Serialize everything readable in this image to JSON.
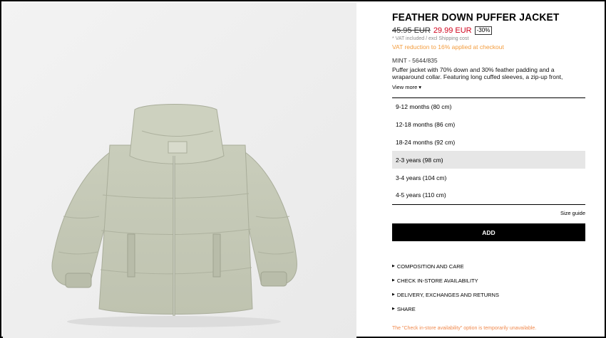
{
  "product": {
    "title": "FEATHER DOWN PUFFER JACKET",
    "old_price": "45.95 EUR",
    "new_price": "29.99 EUR",
    "discount": "-30%",
    "vat_note": "* VAT included / excl Shipping cost",
    "vat_reduction": "VAT reduction to 16% applied at checkout",
    "color_ref": "MINT - 5644/835",
    "description": "Puffer jacket with 70% down and 30% feather padding and a wraparound collar. Featuring long cuffed sleeves, a zip-up front,",
    "view_more": "View more",
    "image_icon": "product-photo"
  },
  "sizes": [
    {
      "label": "9-12 months (80 cm)",
      "selected": false
    },
    {
      "label": "12-18 months (86 cm)",
      "selected": false
    },
    {
      "label": "18-24 months (92 cm)",
      "selected": false
    },
    {
      "label": "2-3 years (98 cm)",
      "selected": true
    },
    {
      "label": "3-4 years (104 cm)",
      "selected": false
    },
    {
      "label": "4-5 years (110 cm)",
      "selected": false
    }
  ],
  "size_guide": "Size guide",
  "add_button": "ADD",
  "links": [
    "COMPOSITION AND CARE",
    "CHECK IN-STORE AVAILABILITY",
    "DELIVERY, EXCHANGES AND RETURNS",
    "SHARE"
  ],
  "notice": "The \"Check in-store availability\" option is temporarily unavailable.",
  "colors": {
    "sale": "#d0021b",
    "vat_reduction": "#f39c3d",
    "notice": "#f0894d",
    "selected_size_bg": "#e6e6e6",
    "jacket": "#c3c7b4"
  }
}
